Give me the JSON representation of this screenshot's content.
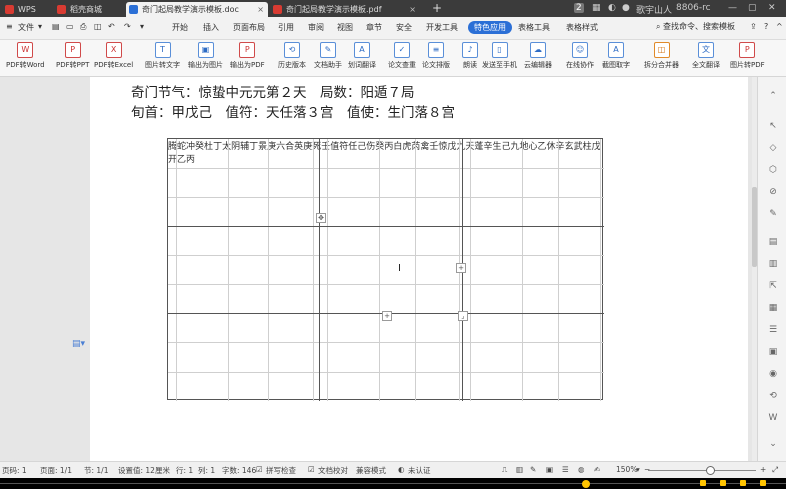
{
  "tabs": [
    {
      "label": "WPS",
      "color": "#d83b32"
    },
    {
      "label": "稻壳商城",
      "color": "#d83b32"
    },
    {
      "label": "奇门起局教学演示模板.doc",
      "color": "#2b6fd6",
      "active": true
    },
    {
      "label": "奇门起局教学演示模板.pdf",
      "color": "#d83b32"
    }
  ],
  "titlebar": {
    "badge": "2",
    "user": "歌宇山人",
    "code": "8806-rc"
  },
  "menu": {
    "file": "文件",
    "items": [
      "开始",
      "插入",
      "页面布局",
      "引用",
      "审阅",
      "视图",
      "章节",
      "安全",
      "开发工具",
      "特色应用",
      "表格工具",
      "表格样式"
    ],
    "highlight_index": 9,
    "search": "查找命令、搜索模板"
  },
  "toolbar": [
    {
      "label": "PDF转Word",
      "glyph": "W"
    },
    {
      "label": "PDF转PPT",
      "glyph": "P"
    },
    {
      "label": "PDF转Excel",
      "glyph": "X"
    },
    {
      "label": "图片转文字",
      "glyph": "T"
    },
    {
      "label": "输出为图片",
      "glyph": "▣"
    },
    {
      "label": "输出为PDF",
      "glyph": "P"
    },
    {
      "label": "历史版本",
      "glyph": "⟲"
    },
    {
      "label": "文档助手",
      "glyph": "✎"
    },
    {
      "label": "划词翻译",
      "glyph": "A"
    },
    {
      "label": "论文查重",
      "glyph": "✓"
    },
    {
      "label": "论文排版",
      "glyph": "≡"
    },
    {
      "label": "朗读",
      "glyph": "♪"
    },
    {
      "label": "发送至手机",
      "glyph": "▯"
    },
    {
      "label": "云编辑器",
      "glyph": "☁"
    },
    {
      "label": "在线协作",
      "glyph": "☺"
    },
    {
      "label": "截图取字",
      "glyph": "A"
    },
    {
      "label": "拆分合并器",
      "glyph": "◫"
    },
    {
      "label": "全文翻译",
      "glyph": "文"
    },
    {
      "label": "图片转PDF",
      "glyph": "P"
    }
  ],
  "doc": {
    "line1": "奇门节气：惊蛰中元元第２天　局数：阳遁７局",
    "line2": "旬首：甲戊己　值符：天任落３宫　值使：生门落８宫"
  },
  "palaces": [
    {
      "god": "腾蛇",
      "star": "冲",
      "heaven": "癸",
      "door": "杜",
      "earth": "丁"
    },
    {
      "god": "太阴",
      "star": "辅",
      "heaven": "丁",
      "door": "景",
      "earth": "庚"
    },
    {
      "god": "六合",
      "star": "英",
      "heaven": "庚",
      "door": "死",
      "earth": "壬"
    },
    {
      "god": "值符",
      "star": "任",
      "heaven": "己",
      "door": "伤",
      "earth": "癸"
    },
    {
      "god": "",
      "star": "",
      "heaven": "",
      "door": "",
      "earth": "丙"
    },
    {
      "god": "白虎",
      "star": "芮禽",
      "heaven": "壬",
      "door": "惊",
      "earth": "戊"
    },
    {
      "god": "九天",
      "star": "蓬",
      "heaven": "辛",
      "door": "生",
      "earth": "己"
    },
    {
      "god": "九地",
      "star": "心",
      "heaven": "乙",
      "door": "休",
      "earth": "辛"
    },
    {
      "god": "玄武",
      "star": "柱",
      "heaven": "戊",
      "door": "开",
      "earth": "乙"
    }
  ],
  "center_side": "丙",
  "status": {
    "page_code": "页码: 1",
    "pages": "页面: 1/1",
    "section": "节: 1/1",
    "setting": "设置值: 12厘米",
    "row": "行: 1",
    "col": "列: 1",
    "words": "字数: 146",
    "spell": "拼写检查",
    "proof": "文档校对",
    "compat": "兼容模式",
    "cert": "未认证",
    "zoom": "150%"
  }
}
